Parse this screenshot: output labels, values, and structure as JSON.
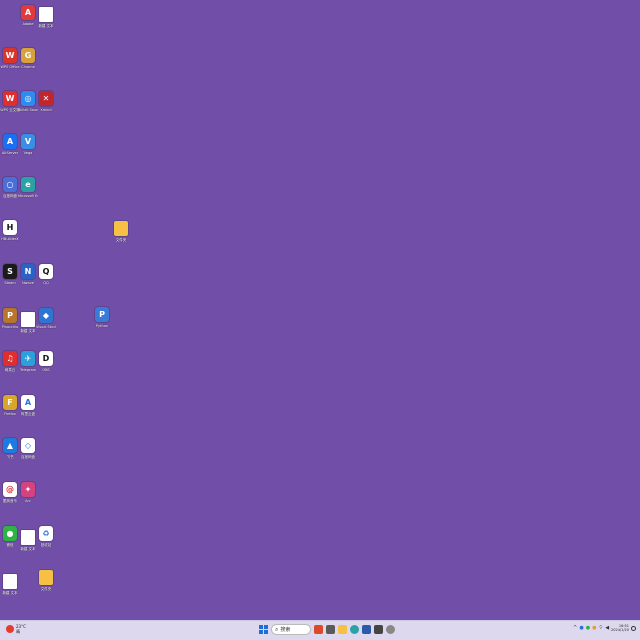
{
  "desktop": {
    "icons": [
      {
        "label": "Adobe",
        "glyph": "A",
        "color": "#e03a3e"
      },
      {
        "label": "新建 文本",
        "glyph": "",
        "color": "#ffffff",
        "doc": true
      },
      {
        "label": "WPS Office",
        "glyph": "W",
        "color": "#d9352b"
      },
      {
        "label": "Chrome",
        "glyph": "G",
        "color": "#d7a23c"
      },
      {
        "label": "WPS 云文档",
        "glyph": "W",
        "color": "#e02e2e"
      },
      {
        "label": "Bilibili Sound",
        "glyph": "◎",
        "color": "#2d8cf0"
      },
      {
        "label": "Xmind",
        "glyph": "✕",
        "color": "#c0272d"
      },
      {
        "label": "AltServer",
        "glyph": "A",
        "color": "#1b6ff5"
      },
      {
        "label": "Vega",
        "glyph": "V",
        "color": "#3a8ee6"
      },
      {
        "label": "百度网盘",
        "glyph": "○",
        "color": "#4b6fd9"
      },
      {
        "label": "Microsoft Edge",
        "glyph": "e",
        "color": "#2aa3a6"
      },
      {
        "label": "HBuilderX",
        "glyph": "H",
        "color": "#ffffff",
        "dark": true
      },
      {
        "label": "Steam",
        "glyph": "S",
        "color": "#1b1b1b"
      },
      {
        "label": "Nwave",
        "glyph": "N",
        "color": "#2a62c8"
      },
      {
        "label": "QQ",
        "glyph": "Q",
        "color": "#ffffff",
        "dark": true
      },
      {
        "label": "Pinocchio",
        "glyph": "P",
        "color": "#b8762c"
      },
      {
        "label": "新建 文本",
        "glyph": "",
        "color": "#ffffff",
        "doc": true
      },
      {
        "label": "Visual Studio",
        "glyph": "◆",
        "color": "#2f74d0"
      },
      {
        "label": "网易云",
        "glyph": "♫",
        "color": "#e02d2d"
      },
      {
        "label": "Telegram",
        "glyph": "✈",
        "color": "#2aa1da"
      },
      {
        "label": "OBS",
        "glyph": "D",
        "color": "#ffffff",
        "dark": true
      },
      {
        "label": "Firefox",
        "glyph": "F",
        "color": "#d6a72a"
      },
      {
        "label": "阿里云盘",
        "glyph": "A",
        "color": "#ffffff",
        "dark": true
      },
      {
        "label": "飞书",
        "glyph": "▲",
        "color": "#1f7ae0"
      },
      {
        "label": "百度网盘",
        "glyph": "◇",
        "color": "#ffffff",
        "dark": true
      },
      {
        "label": "酷狗音乐",
        "glyph": "@",
        "color": "#ffffff",
        "dark": true
      },
      {
        "label": "Arc",
        "glyph": "✦",
        "color": "#d4427f"
      },
      {
        "label": "微信",
        "glyph": "●",
        "color": "#2fb344"
      },
      {
        "label": "新建 文本",
        "glyph": "",
        "color": "#ffffff",
        "doc": true
      },
      {
        "label": "回收站",
        "glyph": "♻",
        "color": "#ffffff",
        "dark": true
      },
      {
        "label": "新建 文本",
        "glyph": "",
        "color": "#ffffff",
        "doc": true
      },
      {
        "label": "文件夹",
        "glyph": "",
        "color": "#f5c044",
        "folder": true
      },
      {
        "label": "文件夹",
        "glyph": "",
        "color": "#f5c044",
        "folder": true
      },
      {
        "label": "Python",
        "glyph": "P",
        "color": "#3b7ad6"
      }
    ]
  },
  "taskbar": {
    "weather_temp": "23°C",
    "weather_desc": "晴",
    "search_placeholder": "搜索",
    "time": "16:51",
    "date": "2024/1/20"
  }
}
